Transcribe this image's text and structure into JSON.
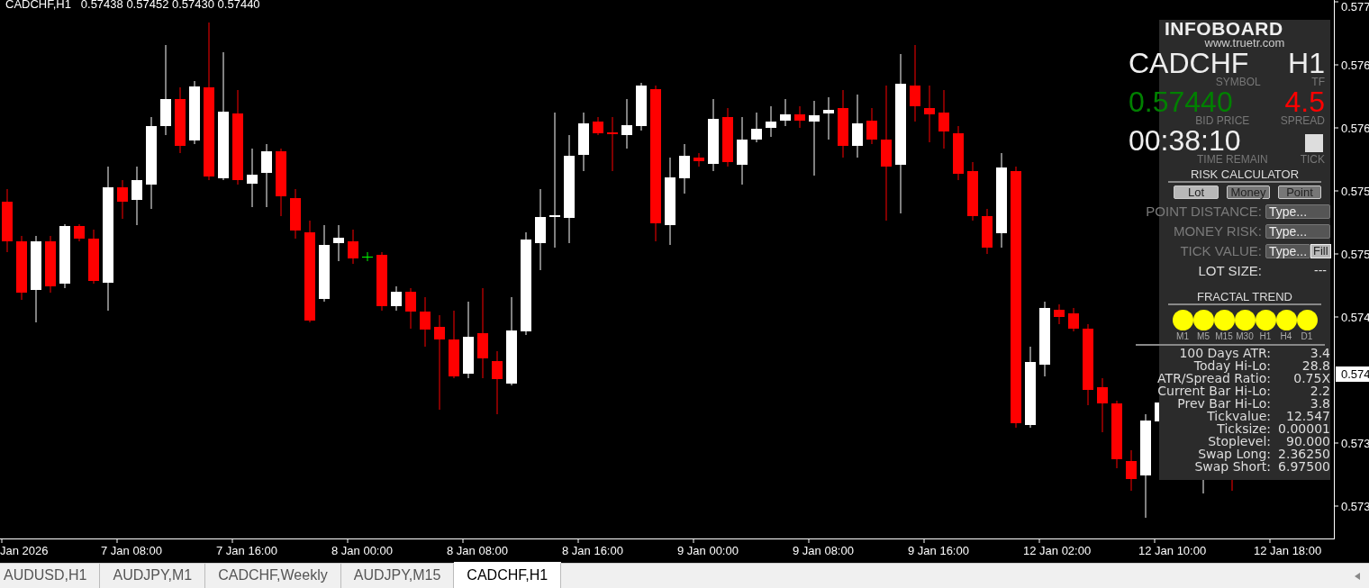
{
  "chart": {
    "header": "CADCHF,H1   0.57438 0.57452 0.57430 0.57440",
    "price_labels": [
      "0.577",
      "0.576",
      "0.576",
      "0.575",
      "0.575",
      "0.574",
      "0.573",
      "0.573"
    ],
    "current_price": "0.574",
    "time_labels": [
      "Jan 2026",
      "7 Jan 08:00",
      "7 Jan 16:00",
      "8 Jan 00:00",
      "8 Jan 08:00",
      "8 Jan 16:00",
      "9 Jan 00:00",
      "9 Jan 08:00",
      "9 Jan 16:00",
      "12 Jan 02:00",
      "12 Jan 10:00",
      "12 Jan 18:00"
    ]
  },
  "infoboard": {
    "title": "INFOBOARD",
    "url": "www.truetr.com",
    "symbol": "CADCHF",
    "symbol_caption": "SYMBOL",
    "timeframe": "H1",
    "timeframe_caption": "TF",
    "bid_price": "0.57440",
    "bid_caption": "BID PRICE",
    "spread": "4.5",
    "spread_caption": "SPREAD",
    "time_remain": "00:38:10",
    "time_caption": "TIME REMAIN",
    "tick_caption": "TICK",
    "risk_title": "RISK CALCULATOR",
    "modes": [
      {
        "label": "Lot",
        "selected": true
      },
      {
        "label": "Money",
        "selected": false
      },
      {
        "label": "Point",
        "selected": false
      }
    ],
    "inputs": [
      {
        "label": "POINT DISTANCE:",
        "value": "Type...",
        "disabled": true
      },
      {
        "label": "MONEY RISK:",
        "value": "Type...",
        "disabled": true
      },
      {
        "label": "TICK VALUE:",
        "value": "Type...",
        "disabled": true,
        "button": "Fill"
      }
    ],
    "lot_size": {
      "label": "LOT SIZE:",
      "value": "---"
    },
    "trend_title": "FRACTAL TREND",
    "trend": [
      {
        "label": "M1",
        "color": "#ffff00"
      },
      {
        "label": "M5",
        "color": "#ffff00"
      },
      {
        "label": "M15",
        "color": "#ffff00"
      },
      {
        "label": "M30",
        "color": "#ffff00"
      },
      {
        "label": "H1",
        "color": "#ffff00"
      },
      {
        "label": "H4",
        "color": "#ffff00"
      },
      {
        "label": "D1",
        "color": "#ffff00"
      }
    ],
    "stats": [
      {
        "label": "100 Days ATR:",
        "value": "3.4"
      },
      {
        "label": "Today Hi-Lo:",
        "value": "28.8"
      },
      {
        "label": "ATR/Spread Ratio:",
        "value": "0.75X"
      },
      {
        "label": "Current Bar Hi-Lo:",
        "value": "2.2"
      },
      {
        "label": "Prev Bar Hi-Lo:",
        "value": "3.8"
      },
      {
        "label": "Tickvalue:",
        "value": "12.547"
      },
      {
        "label": "Ticksize:",
        "value": "0.00001"
      },
      {
        "label": "Stoplevel:",
        "value": "90.000"
      },
      {
        "label": "Swap Long:",
        "value": "2.36250"
      },
      {
        "label": "Swap Short:",
        "value": "6.97500"
      }
    ]
  },
  "tabs": [
    {
      "label": "AUDUSD,H1",
      "selected": false
    },
    {
      "label": "AUDJPY,M1",
      "selected": false
    },
    {
      "label": "CADCHF,Weekly",
      "selected": false
    },
    {
      "label": "AUDJPY,M15",
      "selected": false
    },
    {
      "label": "CADCHF,H1",
      "selected": true
    }
  ]
}
